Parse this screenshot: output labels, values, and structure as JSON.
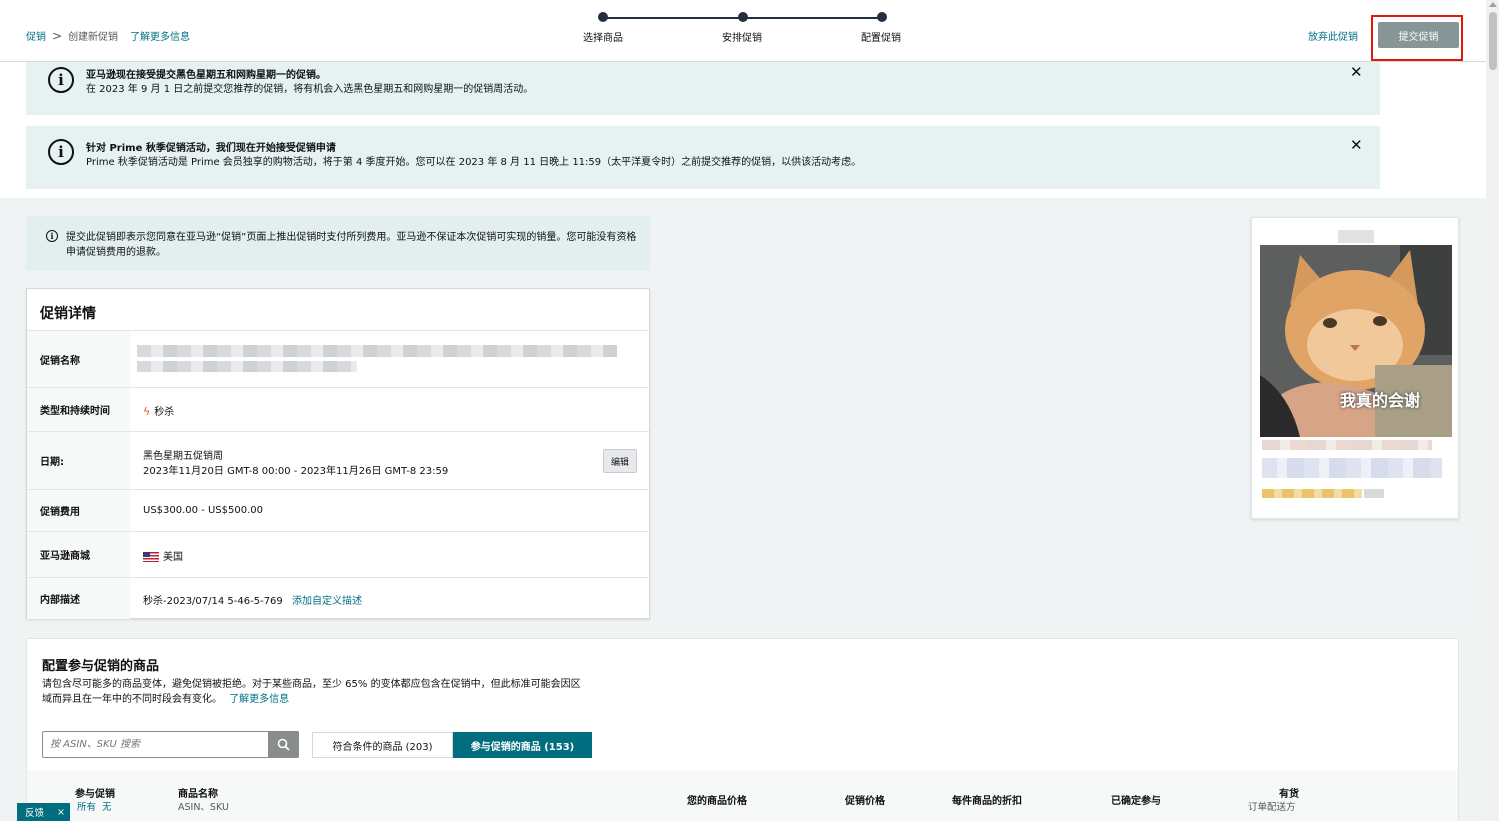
{
  "header": {
    "breadcrumb": {
      "root": "促销",
      "separator": ">",
      "current": "创建新促销",
      "learn_more": "了解更多信息"
    },
    "steps": [
      "选择商品",
      "安排促销",
      "配置促销"
    ],
    "abandon_label": "放弃此促销",
    "submit_label": "提交促销"
  },
  "alerts": [
    {
      "title": "亚马逊现在接受提交黑色星期五和网购星期一的促销。",
      "body": "在 2023 年 9 月 1 日之前提交您推荐的促销，将有机会入选黑色星期五和网购星期一的促销周活动。",
      "close": "✕"
    },
    {
      "title": "针对 Prime 秋季促销活动，我们现在开始接受促销申请",
      "body": "Prime 秋季促销活动是 Prime 会员独享的购物活动，将于第 4 季度开始。您可以在 2023 年 8 月 11 日晚上 11:59（太平洋夏令时）之前提交推荐的促销，以供该活动考虑。",
      "close": "✕"
    }
  ],
  "notice": {
    "text": "提交此促销即表示您同意在亚马逊“促销”页面上推出促销时支付所列费用。亚马逊不保证本次促销可实现的销量。您可能没有资格申请促销费用的退款。"
  },
  "details": {
    "title": "促销详情",
    "rows": {
      "name": {
        "label": "促销名称"
      },
      "type": {
        "label": "类型和持续时间",
        "value": "秒杀"
      },
      "date": {
        "label": "日期:",
        "line1": "黑色星期五促销周",
        "line2": "2023年11月20日 GMT-8 00:00 - 2023年11月26日 GMT-8 23:59",
        "edit": "编辑"
      },
      "fee": {
        "label": "促销费用",
        "value": "US$300.00 - US$500.00"
      },
      "marketplace": {
        "label": "亚马逊商城",
        "value": "美国"
      },
      "internal": {
        "label": "内部描述",
        "value": "秒杀-2023/07/14 5-46-5-769",
        "add_link": "添加自定义描述"
      }
    }
  },
  "preview": {
    "image_caption": "我真的会谢"
  },
  "products": {
    "title": "配置参与促销的商品",
    "desc": "请包含尽可能多的商品变体，避免促销被拒绝。对于某些商品，至少 65% 的变体都应包含在促销中，但此标准可能会因区域而异且在一年中的不同时段会有变化。",
    "desc_link": "了解更多信息",
    "search_placeholder": "按 ASIN、SKU 搜索",
    "tabs": {
      "eligible": "符合条件的商品 (203)",
      "participating": "参与促销的商品 (153)"
    },
    "columns": {
      "participate": "参与促销",
      "participate_all": "所有",
      "participate_none": "无",
      "product_name": "商品名称",
      "product_sub": "ASIN、SKU",
      "your_price": "您的商品价格",
      "deal_price": "促销价格",
      "discount": "每件商品的折扣",
      "committed": "已确定参与",
      "stock": "有货",
      "stock_sub": "订单配送方"
    }
  },
  "feedback": {
    "label": "反馈",
    "close": "×"
  }
}
